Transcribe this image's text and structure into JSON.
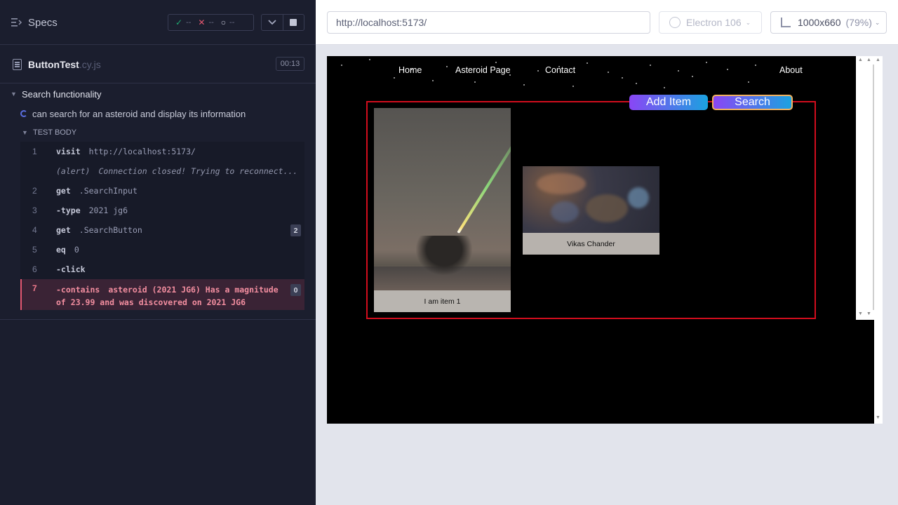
{
  "reporter": {
    "specs_label": "Specs",
    "stats": {
      "passed": "--",
      "failed": "--",
      "pending": "--"
    },
    "file": {
      "name": "ButtonTest",
      "ext": ".cy.js",
      "duration": "00:13"
    },
    "suite_title": "Search functionality",
    "test_title": "can search for an asteroid and display its information",
    "test_body_label": "TEST BODY",
    "commands": [
      {
        "num": "1",
        "name": "visit",
        "msg": "http://localhost:5173/",
        "count": ""
      },
      {
        "num": "",
        "name": "(alert)",
        "msg": "Connection closed! Trying to reconnect...",
        "count": "",
        "italic": true
      },
      {
        "num": "2",
        "name": "get",
        "msg": ".SearchInput",
        "count": ""
      },
      {
        "num": "3",
        "name": "-type",
        "msg": "2021 jg6",
        "count": ""
      },
      {
        "num": "4",
        "name": "get",
        "msg": ".SearchButton",
        "count": "2"
      },
      {
        "num": "5",
        "name": "eq",
        "msg": "0",
        "count": ""
      },
      {
        "num": "6",
        "name": "-click",
        "msg": "",
        "count": ""
      }
    ],
    "failed_command": {
      "num": "7",
      "name": "-contains",
      "msg_line1": "asteroid (2021 JG6) Has a magnitude",
      "msg_line2": "of 23.99 and was discovered on 2021 JG6",
      "count": "0"
    }
  },
  "aut_header": {
    "url": "http://localhost:5173/",
    "browser": "Electron 106",
    "viewport": "1000x660",
    "zoom": "(79%)"
  },
  "app": {
    "nav": {
      "home": "Home",
      "asteroid": "Asteroid Page",
      "contact": "Contact",
      "about": "About"
    },
    "add_item_label": "Add Item",
    "search_label": "Search",
    "card1_caption": "I am item 1",
    "card2_caption": "Vikas Chander"
  },
  "colors": {
    "frame_border": "#d20d1d",
    "failed_text": "#f38ea0",
    "reporter_bg": "#1b1e2e"
  }
}
